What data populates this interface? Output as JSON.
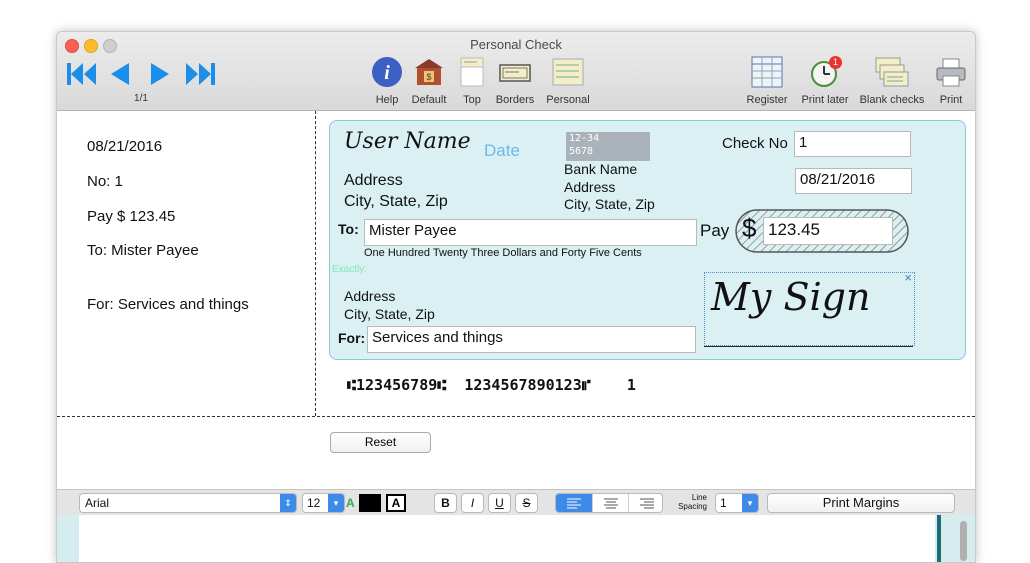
{
  "window": {
    "title": "Personal Check"
  },
  "toolbar": {
    "page_indicator": "1/1",
    "buttons": [
      {
        "label": "Help",
        "icon": "info-icon"
      },
      {
        "label": "Default",
        "icon": "bank-icon"
      },
      {
        "label": "Top",
        "icon": "top-icon"
      },
      {
        "label": "Borders",
        "icon": "borders-icon"
      },
      {
        "label": "Personal",
        "icon": "personal-icon"
      },
      {
        "label": "Register",
        "icon": "register-icon"
      },
      {
        "label": "Print later",
        "icon": "print-later-icon",
        "badge": "1"
      },
      {
        "label": "Blank checks",
        "icon": "blank-checks-icon"
      },
      {
        "label": "Print",
        "icon": "printer-icon"
      }
    ]
  },
  "stub": {
    "date": "08/21/2016",
    "no": "No: 1",
    "pay": "Pay $ 123.45",
    "to": "To: Mister Payee",
    "for": "For: Services and things"
  },
  "check": {
    "user_name": "User Name",
    "date_placeholder": "Date",
    "routing_box_line1": "12-34",
    "routing_box_line2": "5678",
    "address": "Address",
    "city_state_zip": "City, State, Zip",
    "bank_name": "Bank Name",
    "bank_address": "Address",
    "bank_city_state_zip": "City, State, Zip",
    "check_no_label": "Check No",
    "check_no_value": "1",
    "date_value": "08/21/2016",
    "to_label": "To:",
    "payee": "Mister Payee",
    "pay_label": "Pay",
    "dollar_sign": "$",
    "amount": "123.45",
    "amount_words": "One Hundred Twenty Three Dollars and Forty Five Cents",
    "exactly_label": "Exactly:",
    "payee_address": "Address",
    "payee_city_state_zip": "City, State, Zip",
    "for_label": "For:",
    "memo": "Services and things",
    "signature": "My Sign",
    "signature_close": "×",
    "micr": "⑆123456789⑆  1234567890123⑈    1"
  },
  "reset_label": "Reset",
  "format_bar": {
    "font": "Arial",
    "size": "12",
    "color_a": "A",
    "outline_a": "A",
    "bold": "B",
    "italic": "I",
    "underline": "U",
    "strike": "S",
    "line_label_1": "Line",
    "line_label_2": "Spacing",
    "line_spacing": "1",
    "print_margins": "Print Margins"
  },
  "colors": {
    "check_bg": "#daf0f3",
    "accent_blue": "#1a8ee8",
    "date_hint": "#6fb7e6"
  }
}
